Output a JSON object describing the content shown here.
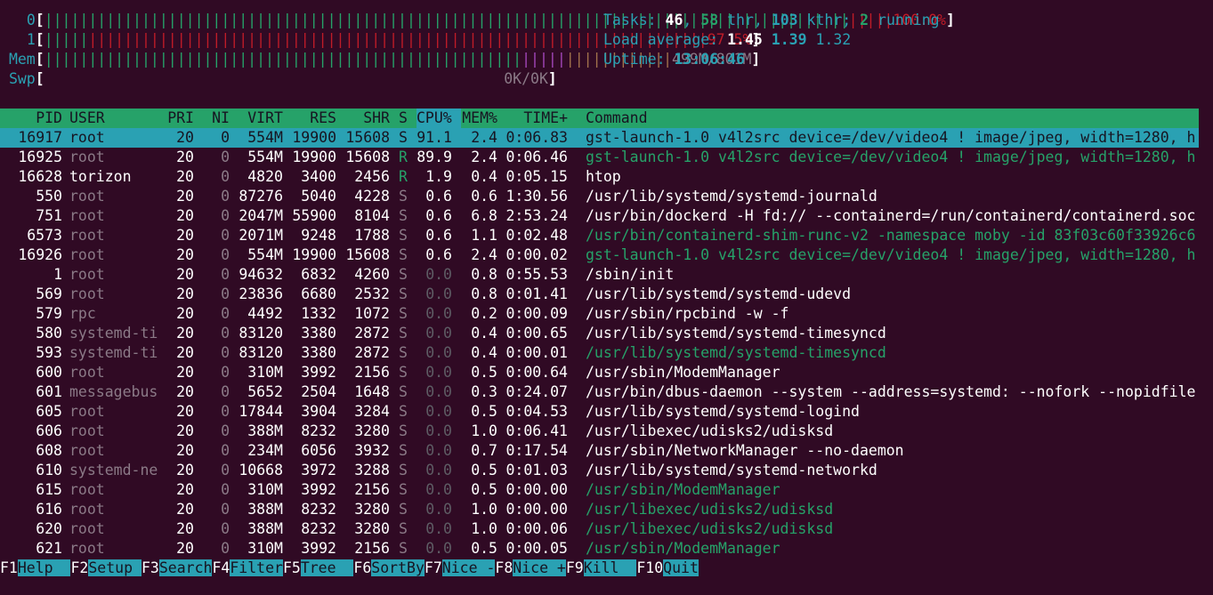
{
  "meters": {
    "cpu0": {
      "label": "0",
      "value": "100.0%"
    },
    "cpu1": {
      "label": "1",
      "value": "97.5%"
    },
    "mem": {
      "label": "Mem",
      "value": "499M/801M"
    },
    "swp": {
      "label": "Swp",
      "value": "0K/0K"
    }
  },
  "stats": {
    "tasks_label": "Tasks:",
    "tasks": "46",
    "thr": "58",
    "thr_label": "thr,",
    "kthr": "103",
    "kthr_label": "kthr;",
    "running": "2",
    "running_label": "running",
    "load_label": "Load average:",
    "load1": "1.45",
    "load5": "1.39",
    "load15": "1.32",
    "uptime_label": "Uptime:",
    "uptime": "13:06:46"
  },
  "columns": [
    "PID",
    "USER",
    "PRI",
    "NI",
    "VIRT",
    "RES",
    "SHR",
    "S",
    "CPU%",
    "MEM%",
    "TIME+",
    "Command"
  ],
  "processes": [
    {
      "pid": "16917",
      "user": "root",
      "pri": "20",
      "ni": "0",
      "virt": "554M",
      "res": "19900",
      "shr": "15608",
      "s": "S",
      "cpu": "91.1",
      "mem": "2.4",
      "time": "0:06.83",
      "cmd": "gst-launch-1.0 v4l2src device=/dev/video4 ! image/jpeg, width=1280, h",
      "thread": false,
      "selected": true
    },
    {
      "pid": "16925",
      "user": "root",
      "pri": "20",
      "ni": "0",
      "virt": "554M",
      "res": "19900",
      "shr": "15608",
      "s": "R",
      "cpu": "89.9",
      "mem": "2.4",
      "time": "0:06.46",
      "cmd": "gst-launch-1.0 v4l2src device=/dev/video4 ! image/jpeg, width=1280, h",
      "thread": true,
      "selected": false
    },
    {
      "pid": "16628",
      "user": "torizon",
      "pri": "20",
      "ni": "0",
      "virt": "4820",
      "res": "3400",
      "shr": "2456",
      "s": "R",
      "cpu": "1.9",
      "mem": "0.4",
      "time": "0:05.15",
      "cmd": "htop",
      "thread": false,
      "selected": false
    },
    {
      "pid": "550",
      "user": "root",
      "pri": "20",
      "ni": "0",
      "virt": "87276",
      "res": "5040",
      "shr": "4228",
      "s": "S",
      "cpu": "0.6",
      "mem": "0.6",
      "time": "1:30.56",
      "cmd": "/usr/lib/systemd/systemd-journald",
      "thread": false,
      "selected": false
    },
    {
      "pid": "751",
      "user": "root",
      "pri": "20",
      "ni": "0",
      "virt": "2047M",
      "res": "55900",
      "shr": "8104",
      "s": "S",
      "cpu": "0.6",
      "mem": "6.8",
      "time": "2:53.24",
      "cmd": "/usr/bin/dockerd -H fd:// --containerd=/run/containerd/containerd.soc",
      "thread": false,
      "selected": false
    },
    {
      "pid": "6573",
      "user": "root",
      "pri": "20",
      "ni": "0",
      "virt": "2071M",
      "res": "9248",
      "shr": "1788",
      "s": "S",
      "cpu": "0.6",
      "mem": "1.1",
      "time": "0:02.48",
      "cmd": "/usr/bin/containerd-shim-runc-v2 -namespace moby -id 83f03c60f33926c6",
      "thread": true,
      "selected": false
    },
    {
      "pid": "16926",
      "user": "root",
      "pri": "20",
      "ni": "0",
      "virt": "554M",
      "res": "19900",
      "shr": "15608",
      "s": "S",
      "cpu": "0.6",
      "mem": "2.4",
      "time": "0:00.02",
      "cmd": "gst-launch-1.0 v4l2src device=/dev/video4 ! image/jpeg, width=1280, h",
      "thread": true,
      "selected": false
    },
    {
      "pid": "1",
      "user": "root",
      "pri": "20",
      "ni": "0",
      "virt": "94632",
      "res": "6832",
      "shr": "4260",
      "s": "S",
      "cpu": "0.0",
      "mem": "0.8",
      "time": "0:55.53",
      "cmd": "/sbin/init",
      "thread": false,
      "selected": false
    },
    {
      "pid": "569",
      "user": "root",
      "pri": "20",
      "ni": "0",
      "virt": "23836",
      "res": "6680",
      "shr": "2532",
      "s": "S",
      "cpu": "0.0",
      "mem": "0.8",
      "time": "0:01.41",
      "cmd": "/usr/lib/systemd/systemd-udevd",
      "thread": false,
      "selected": false
    },
    {
      "pid": "579",
      "user": "rpc",
      "pri": "20",
      "ni": "0",
      "virt": "4492",
      "res": "1332",
      "shr": "1072",
      "s": "S",
      "cpu": "0.0",
      "mem": "0.2",
      "time": "0:00.09",
      "cmd": "/usr/sbin/rpcbind -w -f",
      "thread": false,
      "selected": false
    },
    {
      "pid": "580",
      "user": "systemd-ti",
      "pri": "20",
      "ni": "0",
      "virt": "83120",
      "res": "3380",
      "shr": "2872",
      "s": "S",
      "cpu": "0.0",
      "mem": "0.4",
      "time": "0:00.65",
      "cmd": "/usr/lib/systemd/systemd-timesyncd",
      "thread": false,
      "selected": false
    },
    {
      "pid": "593",
      "user": "systemd-ti",
      "pri": "20",
      "ni": "0",
      "virt": "83120",
      "res": "3380",
      "shr": "2872",
      "s": "S",
      "cpu": "0.0",
      "mem": "0.4",
      "time": "0:00.01",
      "cmd": "/usr/lib/systemd/systemd-timesyncd",
      "thread": true,
      "selected": false
    },
    {
      "pid": "600",
      "user": "root",
      "pri": "20",
      "ni": "0",
      "virt": "310M",
      "res": "3992",
      "shr": "2156",
      "s": "S",
      "cpu": "0.0",
      "mem": "0.5",
      "time": "0:00.64",
      "cmd": "/usr/sbin/ModemManager",
      "thread": false,
      "selected": false
    },
    {
      "pid": "601",
      "user": "messagebus",
      "pri": "20",
      "ni": "0",
      "virt": "5652",
      "res": "2504",
      "shr": "1648",
      "s": "S",
      "cpu": "0.0",
      "mem": "0.3",
      "time": "0:24.07",
      "cmd": "/usr/bin/dbus-daemon --system --address=systemd: --nofork --nopidfile",
      "thread": false,
      "selected": false
    },
    {
      "pid": "605",
      "user": "root",
      "pri": "20",
      "ni": "0",
      "virt": "17844",
      "res": "3904",
      "shr": "3284",
      "s": "S",
      "cpu": "0.0",
      "mem": "0.5",
      "time": "0:04.53",
      "cmd": "/usr/lib/systemd/systemd-logind",
      "thread": false,
      "selected": false
    },
    {
      "pid": "606",
      "user": "root",
      "pri": "20",
      "ni": "0",
      "virt": "388M",
      "res": "8232",
      "shr": "3280",
      "s": "S",
      "cpu": "0.0",
      "mem": "1.0",
      "time": "0:06.41",
      "cmd": "/usr/libexec/udisks2/udisksd",
      "thread": false,
      "selected": false
    },
    {
      "pid": "608",
      "user": "root",
      "pri": "20",
      "ni": "0",
      "virt": "234M",
      "res": "6056",
      "shr": "3932",
      "s": "S",
      "cpu": "0.0",
      "mem": "0.7",
      "time": "0:17.54",
      "cmd": "/usr/sbin/NetworkManager --no-daemon",
      "thread": false,
      "selected": false
    },
    {
      "pid": "610",
      "user": "systemd-ne",
      "pri": "20",
      "ni": "0",
      "virt": "10668",
      "res": "3972",
      "shr": "3288",
      "s": "S",
      "cpu": "0.0",
      "mem": "0.5",
      "time": "0:01.03",
      "cmd": "/usr/lib/systemd/systemd-networkd",
      "thread": false,
      "selected": false
    },
    {
      "pid": "615",
      "user": "root",
      "pri": "20",
      "ni": "0",
      "virt": "310M",
      "res": "3992",
      "shr": "2156",
      "s": "S",
      "cpu": "0.0",
      "mem": "0.5",
      "time": "0:00.00",
      "cmd": "/usr/sbin/ModemManager",
      "thread": true,
      "selected": false
    },
    {
      "pid": "616",
      "user": "root",
      "pri": "20",
      "ni": "0",
      "virt": "388M",
      "res": "8232",
      "shr": "3280",
      "s": "S",
      "cpu": "0.0",
      "mem": "1.0",
      "time": "0:00.00",
      "cmd": "/usr/libexec/udisks2/udisksd",
      "thread": true,
      "selected": false
    },
    {
      "pid": "620",
      "user": "root",
      "pri": "20",
      "ni": "0",
      "virt": "388M",
      "res": "8232",
      "shr": "3280",
      "s": "S",
      "cpu": "0.0",
      "mem": "1.0",
      "time": "0:00.06",
      "cmd": "/usr/libexec/udisks2/udisksd",
      "thread": true,
      "selected": false
    },
    {
      "pid": "621",
      "user": "root",
      "pri": "20",
      "ni": "0",
      "virt": "310M",
      "res": "3992",
      "shr": "2156",
      "s": "S",
      "cpu": "0.0",
      "mem": "0.5",
      "time": "0:00.05",
      "cmd": "/usr/sbin/ModemManager",
      "thread": true,
      "selected": false
    }
  ],
  "footer": [
    {
      "key": "F1",
      "label": "Help  "
    },
    {
      "key": "F2",
      "label": "Setup "
    },
    {
      "key": "F3",
      "label": "Search"
    },
    {
      "key": "F4",
      "label": "Filter"
    },
    {
      "key": "F5",
      "label": "Tree  "
    },
    {
      "key": "F6",
      "label": "SortBy"
    },
    {
      "key": "F7",
      "label": "Nice -"
    },
    {
      "key": "F8",
      "label": "Nice +"
    },
    {
      "key": "F9",
      "label": "Kill  "
    },
    {
      "key": "F10",
      "label": "Quit"
    }
  ],
  "colors": {
    "background": "#300a24",
    "header_bg": "#26a269",
    "selection_bg": "#2aa1b3",
    "bar_red": "#c01c28",
    "bar_green": "#26a269",
    "bar_magenta": "#a347ba",
    "bar_brown": "#a2734c"
  }
}
